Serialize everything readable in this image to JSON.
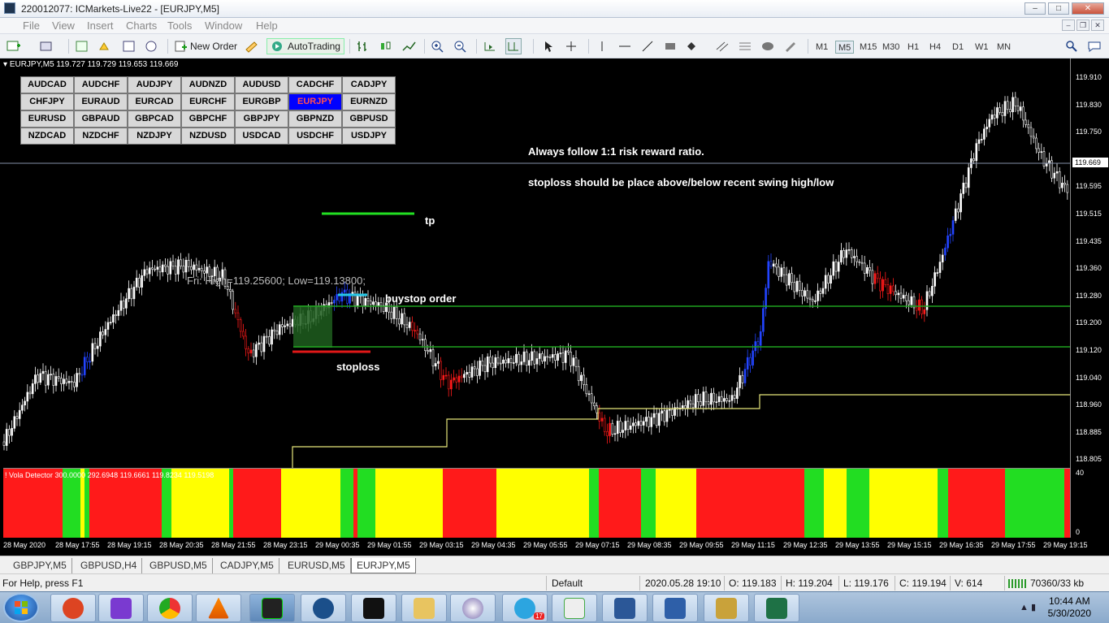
{
  "window": {
    "title": "220012077: ICMarkets-Live22 - [EURJPY,M5]"
  },
  "menu": [
    "File",
    "View",
    "Insert",
    "Charts",
    "Tools",
    "Window",
    "Help"
  ],
  "toolbar": {
    "new_order": "New Order",
    "autotrading": "AutoTrading",
    "timeframes": [
      "M1",
      "M5",
      "M15",
      "M30",
      "H1",
      "H4",
      "D1",
      "W1",
      "MN"
    ],
    "active_timeframe": "M5"
  },
  "chart": {
    "header": "EURJPY,M5  119.727 119.729 119.653 119.669",
    "pairs": [
      "AUDCAD",
      "AUDCHF",
      "AUDJPY",
      "AUDNZD",
      "AUDUSD",
      "CADCHF",
      "CADJPY",
      "CHFJPY",
      "EURAUD",
      "EURCAD",
      "EURCHF",
      "EURGBP",
      "EURJPY",
      "EURNZD",
      "EURUSD",
      "GBPAUD",
      "GBPCAD",
      "GBPCHF",
      "GBPJPY",
      "GBPNZD",
      "GBPUSD",
      "NZDCAD",
      "NZDCHF",
      "NZDJPY",
      "NZDUSD",
      "USDCAD",
      "USDCHF",
      "USDJPY"
    ],
    "selected_pair": "EURJPY",
    "annotations": {
      "rule1": "Always follow 1:1 risk reward ratio.",
      "rule2": "stoploss should be place above/below recent swing high/low",
      "tp": "tp",
      "buystop": "buystop order",
      "stoploss": "stoploss",
      "ohlc": "Fri:  High=119.25600;  Low=119.13800;"
    },
    "price_labels": [
      "119.910",
      "119.830",
      "119.750",
      "119.669",
      "119.595",
      "119.515",
      "119.435",
      "119.360",
      "119.280",
      "119.200",
      "119.120",
      "119.040",
      "118.960",
      "118.885",
      "118.805"
    ],
    "current_price": "119.669",
    "indicator": {
      "label": "! Vola Detector 300.0000 292.6948 119.6661 119.8234 119.5198",
      "max": "40",
      "min": "0"
    },
    "time_labels": [
      "28 May 2020",
      "28 May 17:55",
      "28 May 19:15",
      "28 May 20:35",
      "28 May 21:55",
      "28 May 23:15",
      "29 May 00:35",
      "29 May 01:55",
      "29 May 03:15",
      "29 May 04:35",
      "29 May 05:55",
      "29 May 07:15",
      "29 May 08:35",
      "29 May 09:55",
      "29 May 11:15",
      "29 May 12:35",
      "29 May 13:55",
      "29 May 15:15",
      "29 May 16:35",
      "29 May 17:55",
      "29 May 19:15"
    ]
  },
  "tabs": [
    "GBPJPY,M5",
    "GBPUSD,H4",
    "GBPUSD,M5",
    "CADJPY,M5",
    "EURUSD,M5",
    "EURJPY,M5"
  ],
  "active_tab": "EURJPY,M5",
  "status": {
    "help": "For Help, press F1",
    "profile": "Default",
    "datetime": "2020.05.28 19:10",
    "open": "O: 119.183",
    "high": "H: 119.204",
    "low": "L: 119.176",
    "close": "C: 119.194",
    "volume": "V: 614",
    "traffic": "70360/33 kb"
  },
  "taskbar": {
    "time": "10:44 AM",
    "date": "5/30/2020",
    "badge": "17"
  }
}
